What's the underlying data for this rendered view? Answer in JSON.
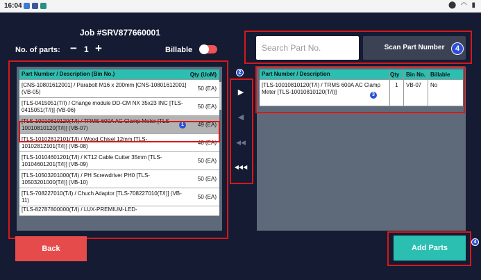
{
  "status_bar": {
    "time": "16:04",
    "icons": [
      "app-icon-blue",
      "facebook-icon",
      "app-icon-teal"
    ],
    "right_icons": [
      "location-icon",
      "wifi-icon",
      "battery-icon"
    ]
  },
  "header": {
    "job_title": "Job #SRV877660001",
    "parts_label": "No. of parts:",
    "minus": "−",
    "qty_value": "1",
    "plus": "+",
    "billable_label": "Billable",
    "billable_on": false
  },
  "search": {
    "placeholder": "Search Part No.",
    "scan_label": "Scan Part Number",
    "annotation": "4"
  },
  "left_table": {
    "headers": {
      "desc": "Part Number / Description (Bin No.)",
      "qty": "Qty (UoM)"
    },
    "rows": [
      {
        "desc": "[CNS-10801612001] / Parabolt M16 x 200mm [CNS-10801612001] (VB-05)",
        "qty": "50 (EA)"
      },
      {
        "desc": "[TLS-0415051(T/I) / Change module DD-CM NX 35x23 INC [TLS-0415051(T/I)] (VB-06)",
        "qty": "50 (EA)"
      },
      {
        "desc": "[TLS-10010810120(T/I) / TRMS 600A AC Clamp Meter [TLS-10010810120(T/I)] (VB-07)",
        "qty": "49 (EA)",
        "badge": "1"
      },
      {
        "desc": "[TLS-10102812101(T/I) / Wood Chisel 12mm [TLS-10102812101(T/I)] (VB-08)",
        "qty": "48 (EA)"
      },
      {
        "desc": "[TLS-10104601201(T/I) / KT12 Cable Cutter 35mm [TLS-10104601201(T/I)] (VB-09)",
        "qty": "50 (EA)"
      },
      {
        "desc": "[TLS-10503201000(T/I) / PH Screwdriver PH0 [TLS-10503201000(T/I)] (VB-10)",
        "qty": "50 (EA)"
      },
      {
        "desc": "[TLS-708227010(T/I) / Chuch Adaptor [TLS-708227010(T/I)] (VB-11)",
        "qty": "50 (EA)"
      },
      {
        "desc": "[TLS-82787800000(T/I) / LUX-PREMIUM-LED-",
        "qty": ""
      }
    ]
  },
  "move_buttons": {
    "annotation": "2",
    "move_one_right": "▶",
    "move_one_left": "◀",
    "move_all_left_double": "◀◀",
    "move_all_left_triple": "◀◀◀"
  },
  "right_table": {
    "headers": {
      "desc": "Part Number / Description",
      "qty": "Qty",
      "bin": "Bin No.",
      "billable": "Billable"
    },
    "rows": [
      {
        "desc": "[TLS-10010810120(T/I) / TRMS 600A AC Clamp Meter [TLS-10010810120(T/I)]",
        "qty": "1",
        "bin": "VB-07",
        "billable": "No",
        "badge": "3"
      }
    ]
  },
  "footer": {
    "back_label": "Back",
    "add_label": "Add Parts",
    "add_annotation": "4"
  },
  "colors": {
    "background": "#141b33",
    "teal": "#2bbfb2",
    "red": "#e64b4b",
    "annotation_red": "#d81818",
    "badge_blue": "#2d4fd6"
  }
}
